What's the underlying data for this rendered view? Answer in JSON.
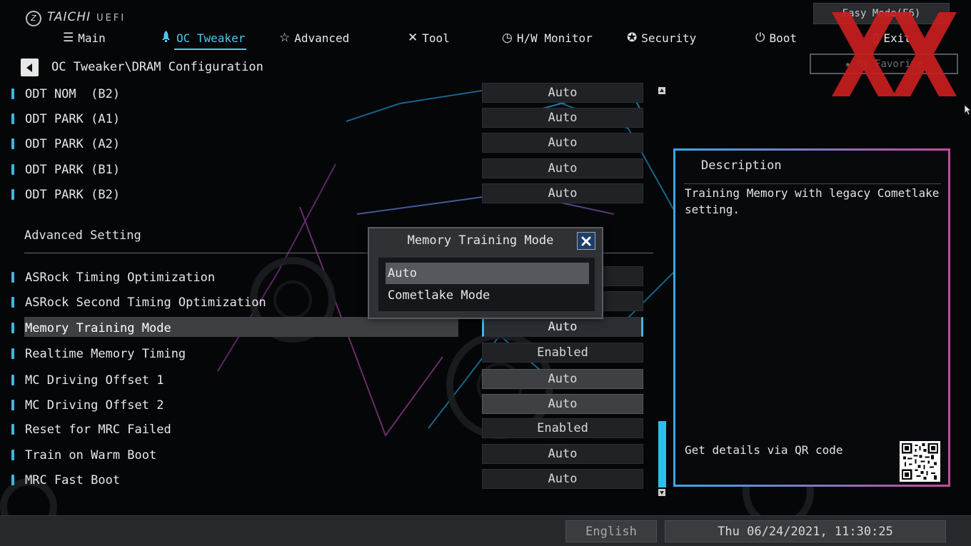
{
  "brand": {
    "name": "TAICHI",
    "suffix": "UEFI"
  },
  "nav": {
    "tabs": [
      {
        "label": "Main",
        "icon": "list-icon"
      },
      {
        "label": "OC Tweaker",
        "icon": "rocket-icon",
        "active": true
      },
      {
        "label": "Advanced",
        "icon": "star-icon"
      },
      {
        "label": "Tool",
        "icon": "tools-icon"
      },
      {
        "label": "H/W Monitor",
        "icon": "monitor-icon"
      },
      {
        "label": "Security",
        "icon": "shield-icon"
      },
      {
        "label": "Boot",
        "icon": "power-icon"
      },
      {
        "label": "Exit",
        "icon": "exit-door-icon"
      }
    ],
    "easy_mode": "Easy Mode(F6)",
    "my_favorite": "My Favorite"
  },
  "breadcrumb": "OC Tweaker\\DRAM Configuration",
  "settings_top": [
    {
      "label": "ODT NOM  (B2)",
      "value": "Auto"
    },
    {
      "label": "ODT PARK (A1)",
      "value": "Auto"
    },
    {
      "label": "ODT PARK (A2)",
      "value": "Auto"
    },
    {
      "label": "ODT PARK (B1)",
      "value": "Auto"
    },
    {
      "label": "ODT PARK (B2)",
      "value": "Auto"
    }
  ],
  "section_title": "Advanced Setting",
  "settings_bottom": [
    {
      "label": "ASRock Timing Optimization",
      "value": ""
    },
    {
      "label": "ASRock Second Timing Optimization",
      "value": ""
    },
    {
      "label": "Memory Training Mode",
      "value": "Auto",
      "selected": true
    },
    {
      "label": "Realtime Memory Timing",
      "value": "Enabled"
    },
    {
      "label": "MC Driving Offset 1",
      "value": "Auto"
    },
    {
      "label": "MC Driving Offset 2",
      "value": "Auto"
    },
    {
      "label": "Reset for MRC Failed",
      "value": "Enabled"
    },
    {
      "label": "Train on Warm Boot",
      "value": "Auto"
    },
    {
      "label": "MRC Fast Boot",
      "value": "Auto"
    }
  ],
  "popup": {
    "title": "Memory Training Mode",
    "options": [
      "Auto",
      "Cometlake Mode"
    ],
    "selected_option": "Auto"
  },
  "description": {
    "title": "Description",
    "text": "Training Memory with legacy Cometlake setting.",
    "qr_label": "Get details via QR code"
  },
  "footer": {
    "language": "English",
    "datetime": "Thu 06/24/2021, 11:30:25"
  },
  "colors": {
    "accent": "#4ec7ee",
    "bullet": "#3fb6e0",
    "watermark": "#c81e1e",
    "panel_border_start": "#3aa8e6",
    "panel_border_end": "#c44aa0"
  }
}
